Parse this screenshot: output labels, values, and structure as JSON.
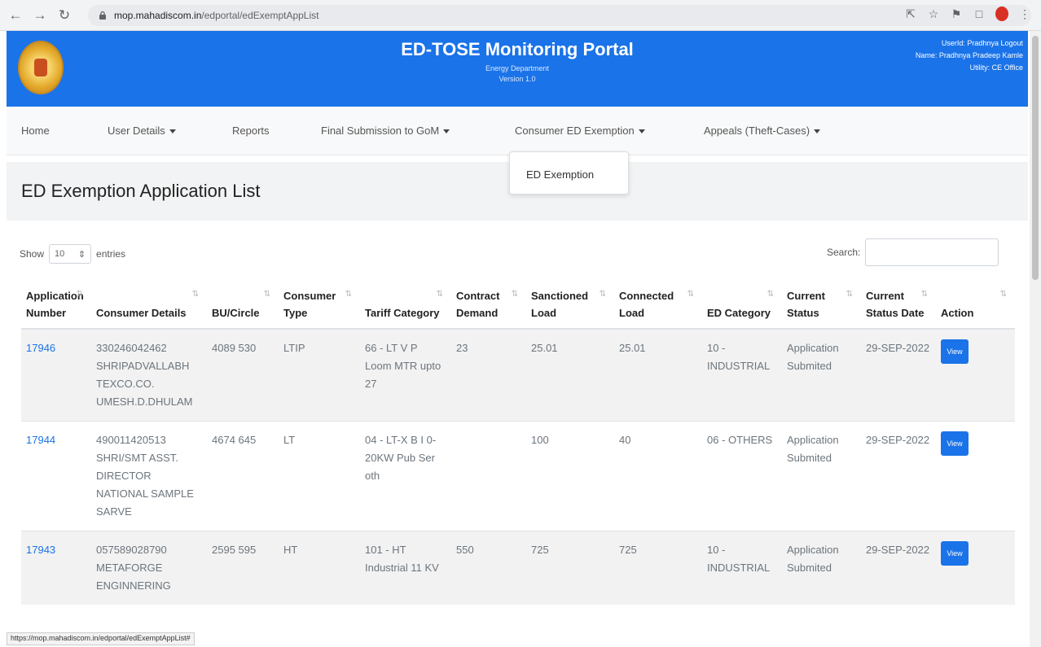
{
  "browser": {
    "url_domain": "mop.mahadiscom.in",
    "url_path": "/edportal/edExemptAppList",
    "status_url": "https://mop.mahadiscom.in/edportal/edExemptAppList#"
  },
  "header": {
    "title": "ED-TOSE Monitoring Portal",
    "subtitle": "Energy Department",
    "version": "Version 1.0",
    "userid_line": "UserId: Pradhnya Logout",
    "name_line": "Name: Pradhnya Pradeep Kamle",
    "utility_line": "Utility: CE Office",
    "bg_color": "#1a73e8"
  },
  "nav": {
    "home": "Home",
    "user_details": "User Details",
    "reports": "Reports",
    "final_submission": "Final Submission to GoM",
    "consumer_ed_exemption": "Consumer ED Exemption",
    "appeals": "Appeals (Theft-Cases)",
    "dropdown_item": "ED Exemption"
  },
  "page": {
    "title": "ED Exemption Application List",
    "show_label": "Show",
    "entries_value": "10",
    "entries_label": "entries",
    "search_label": "Search:"
  },
  "table": {
    "headers": [
      "Application Number",
      "Consumer Details",
      "BU/Circle",
      "Consumer Type",
      "Tariff Category",
      "Contract Demand",
      "Sanctioned Load",
      "Connected Load",
      "ED Category",
      "Current Status",
      "Current Status Date",
      "Action"
    ],
    "rows": [
      {
        "app_no": "17946",
        "consumer": "330246042462 SHRIPADVALLABH TEXCO.CO. UMESH.D.DHULAM",
        "bu": "4089 530",
        "type": "LTIP",
        "tariff": "66 - LT V P Loom MTR upto 27",
        "contract": "23",
        "sanctioned": "25.01",
        "connected": "25.01",
        "ed_cat": "10 - INDUSTRIAL",
        "status": "Application Submited",
        "date": "29-SEP-2022",
        "action": "View"
      },
      {
        "app_no": "17944",
        "consumer": "490011420513 SHRI/SMT ASST. DIRECTOR NATIONAL SAMPLE SARVE",
        "bu": "4674 645",
        "type": "LT",
        "tariff": "04 - LT-X B I 0-20KW Pub Ser oth",
        "contract": "",
        "sanctioned": "100",
        "connected": "40",
        "ed_cat": "06 - OTHERS",
        "status": "Application Submited",
        "date": "29-SEP-2022",
        "action": "View"
      },
      {
        "app_no": "17943",
        "consumer": "057589028790 METAFORGE ENGINNERING",
        "bu": "2595 595",
        "type": "HT",
        "tariff": "101 - HT Industrial 11 KV",
        "contract": "550",
        "sanctioned": "725",
        "connected": "725",
        "ed_cat": "10 - INDUSTRIAL",
        "status": "Application Submited",
        "date": "29-SEP-2022",
        "action": "View"
      }
    ]
  }
}
